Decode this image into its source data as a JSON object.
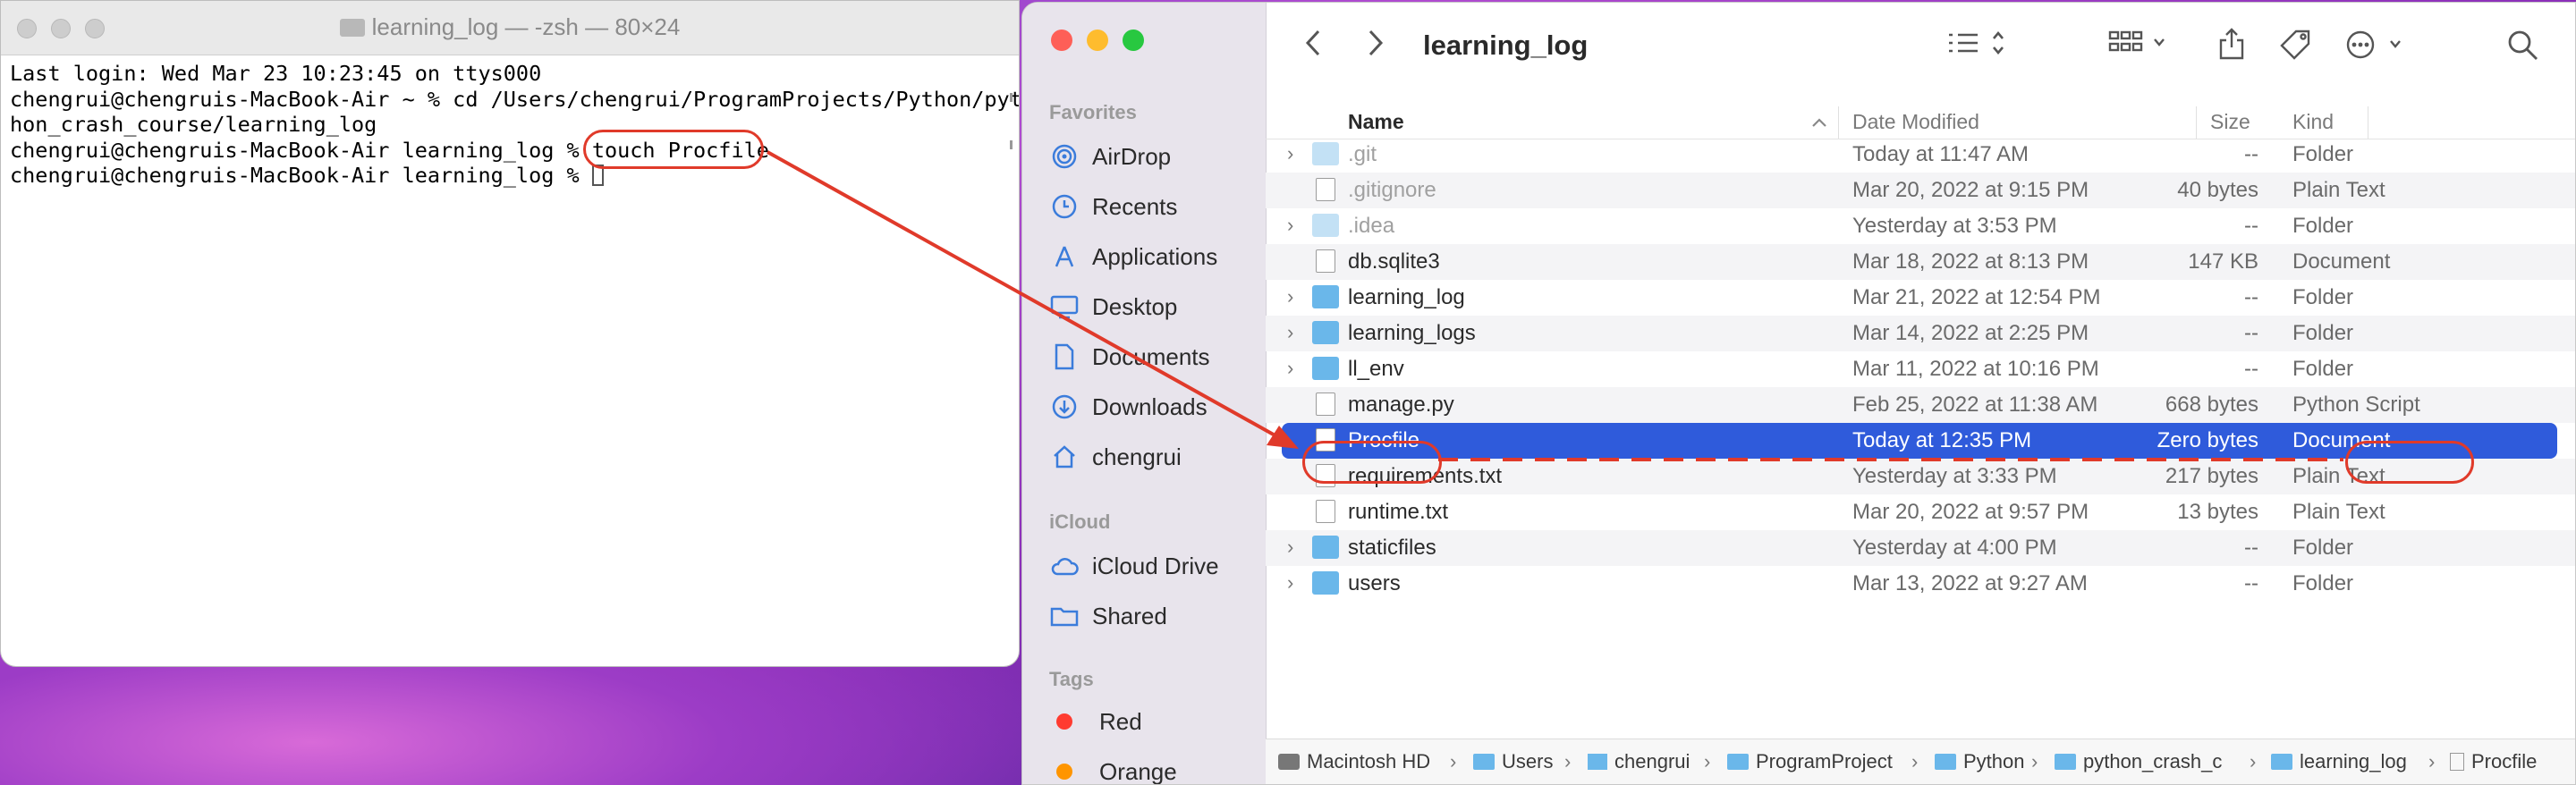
{
  "terminal": {
    "title": "learning_log — -zsh — 80×24",
    "lines": [
      "Last login: Wed Mar 23 10:23:45 on ttys000",
      "chengrui@chengruis-MacBook-Air ~ % cd /Users/chengrui/ProgramProjects/Python/pyt",
      "hon_crash_course/learning_log",
      "chengrui@chengruis-MacBook-Air learning_log % touch Procfile",
      "chengrui@chengruis-MacBook-Air learning_log % "
    ]
  },
  "finder": {
    "title": "learning_log",
    "sidebar": {
      "favorites_heading": "Favorites",
      "favorites": [
        {
          "label": "AirDrop",
          "icon": "airdrop-icon"
        },
        {
          "label": "Recents",
          "icon": "clock-icon"
        },
        {
          "label": "Applications",
          "icon": "applications-icon"
        },
        {
          "label": "Desktop",
          "icon": "desktop-icon"
        },
        {
          "label": "Documents",
          "icon": "document-icon"
        },
        {
          "label": "Downloads",
          "icon": "download-icon"
        },
        {
          "label": "chengrui",
          "icon": "home-icon"
        }
      ],
      "icloud_heading": "iCloud",
      "icloud": [
        {
          "label": "iCloud Drive",
          "icon": "cloud-icon"
        },
        {
          "label": "Shared",
          "icon": "shared-folder-icon"
        }
      ],
      "tags_heading": "Tags",
      "tags": [
        {
          "label": "Red",
          "color": "#ff3b30"
        },
        {
          "label": "Orange",
          "color": "#ff9500"
        }
      ]
    },
    "columns": {
      "name": "Name",
      "date": "Date Modified",
      "size": "Size",
      "kind": "Kind"
    },
    "files": [
      {
        "name": ".git",
        "date": "Today at 11:47 AM",
        "size": "--",
        "kind": "Folder",
        "type": "folder",
        "dim": true,
        "expand": true
      },
      {
        "name": ".gitignore",
        "date": "Mar 20, 2022 at 9:15 PM",
        "size": "40 bytes",
        "kind": "Plain Text",
        "type": "doc",
        "dim": true,
        "expand": false
      },
      {
        "name": ".idea",
        "date": "Yesterday at 3:53 PM",
        "size": "--",
        "kind": "Folder",
        "type": "folder",
        "dim": true,
        "expand": true
      },
      {
        "name": "db.sqlite3",
        "date": "Mar 18, 2022 at 8:13 PM",
        "size": "147 KB",
        "kind": "Document",
        "type": "doc",
        "dim": false,
        "expand": false
      },
      {
        "name": "learning_log",
        "date": "Mar 21, 2022 at 12:54 PM",
        "size": "--",
        "kind": "Folder",
        "type": "folder",
        "dim": false,
        "expand": true
      },
      {
        "name": "learning_logs",
        "date": "Mar 14, 2022 at 2:25 PM",
        "size": "--",
        "kind": "Folder",
        "type": "folder",
        "dim": false,
        "expand": true
      },
      {
        "name": "ll_env",
        "date": "Mar 11, 2022 at 10:16 PM",
        "size": "--",
        "kind": "Folder",
        "type": "folder",
        "dim": false,
        "expand": true
      },
      {
        "name": "manage.py",
        "date": "Feb 25, 2022 at 11:38 AM",
        "size": "668 bytes",
        "kind": "Python Script",
        "type": "doc",
        "dim": false,
        "expand": false
      },
      {
        "name": "Procfile",
        "date": "Today at 12:35 PM",
        "size": "Zero bytes",
        "kind": "Document",
        "type": "doc",
        "dim": false,
        "expand": false,
        "selected": true
      },
      {
        "name": "requirements.txt",
        "date": "Yesterday at 3:33 PM",
        "size": "217 bytes",
        "kind": "Plain Text",
        "type": "doc",
        "dim": false,
        "expand": false
      },
      {
        "name": "runtime.txt",
        "date": "Mar 20, 2022 at 9:57 PM",
        "size": "13 bytes",
        "kind": "Plain Text",
        "type": "doc",
        "dim": false,
        "expand": false
      },
      {
        "name": "staticfiles",
        "date": "Yesterday at 4:00 PM",
        "size": "--",
        "kind": "Folder",
        "type": "folder",
        "dim": false,
        "expand": true
      },
      {
        "name": "users",
        "date": "Mar 13, 2022 at 9:27 AM",
        "size": "--",
        "kind": "Folder",
        "type": "folder",
        "dim": false,
        "expand": true
      }
    ],
    "path": [
      "Macintosh HD",
      "Users",
      "chengrui",
      "ProgramProject",
      "Python",
      "python_crash_c",
      "learning_log",
      "Procfile"
    ],
    "colors": {
      "selection": "#2f5bdb",
      "folder": "#6ab7ea",
      "annotation": "#e03a2a"
    }
  }
}
